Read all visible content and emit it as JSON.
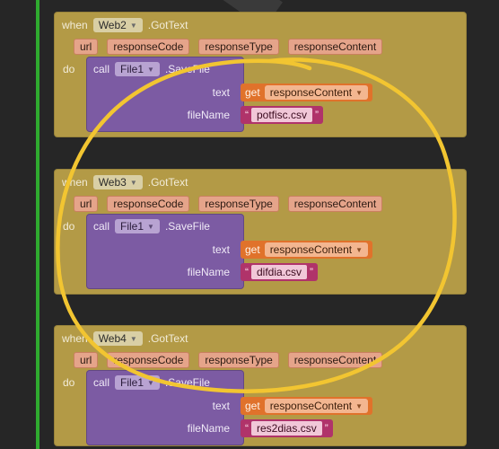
{
  "blocks": [
    {
      "when": "when",
      "component": "Web2",
      "event": ".GotText",
      "params": [
        "url",
        "responseCode",
        "responseType",
        "responseContent"
      ],
      "do": "do",
      "call": {
        "keyword": "call",
        "component": "File1",
        "method": ".SaveFile",
        "text_label": "text",
        "filename_label": "fileName",
        "get_keyword": "get",
        "get_var": "responseContent",
        "filename": "potfisc.csv"
      }
    },
    {
      "when": "when",
      "component": "Web3",
      "event": ".GotText",
      "params": [
        "url",
        "responseCode",
        "responseType",
        "responseContent"
      ],
      "do": "do",
      "call": {
        "keyword": "call",
        "component": "File1",
        "method": ".SaveFile",
        "text_label": "text",
        "filename_label": "fileName",
        "get_keyword": "get",
        "get_var": "responseContent",
        "filename": "difdia.csv"
      }
    },
    {
      "when": "when",
      "component": "Web4",
      "event": ".GotText",
      "params": [
        "url",
        "responseCode",
        "responseType",
        "responseContent"
      ],
      "do": "do",
      "call": {
        "keyword": "call",
        "component": "File1",
        "method": ".SaveFile",
        "text_label": "text",
        "filename_label": "fileName",
        "get_keyword": "get",
        "get_var": "responseContent",
        "filename": "res2dias.csv"
      }
    }
  ],
  "colors": {
    "event_block": "#b39a46",
    "procedure_block": "#7c5ba3",
    "get_block": "#e0722b",
    "text_block": "#b0336a",
    "annotation_circle": "#f2c531",
    "margin_line": "#2faa2f"
  }
}
